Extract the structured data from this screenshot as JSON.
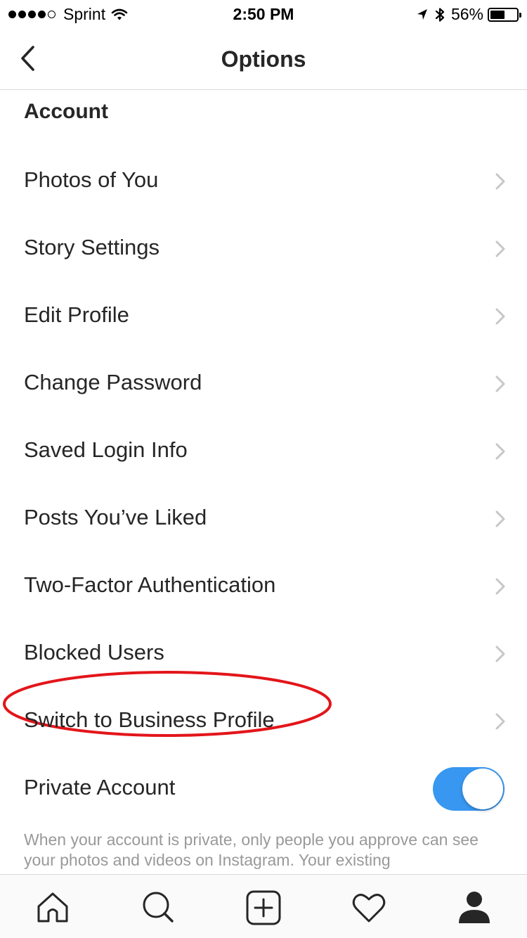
{
  "status_bar": {
    "signal_bars_filled": 4,
    "signal_bars_total": 5,
    "carrier": "Sprint",
    "time": "2:50 PM",
    "battery_percent": "56%",
    "battery_level": 0.56
  },
  "nav": {
    "title": "Options"
  },
  "section": {
    "title": "Account"
  },
  "menu": {
    "items": [
      {
        "label": "Photos of You"
      },
      {
        "label": "Story Settings"
      },
      {
        "label": "Edit Profile"
      },
      {
        "label": "Change Password"
      },
      {
        "label": "Saved Login Info"
      },
      {
        "label": "Posts You’ve Liked"
      },
      {
        "label": "Two-Factor Authentication"
      },
      {
        "label": "Blocked Users"
      },
      {
        "label": "Switch to Business Profile"
      }
    ],
    "private_account": {
      "label": "Private Account",
      "enabled": true
    },
    "private_description": "When your account is private, only people you approve can see your photos and videos on Instagram. Your existing"
  },
  "colors": {
    "toggle_on": "#3897f0",
    "highlight": "#e3151a",
    "text": "#262626",
    "secondary_text": "#999999",
    "chevron": "#c7c7c7"
  },
  "tab_bar": {
    "icons": [
      "home-icon",
      "search-icon",
      "add-post-icon",
      "heart-icon",
      "profile-icon"
    ]
  }
}
